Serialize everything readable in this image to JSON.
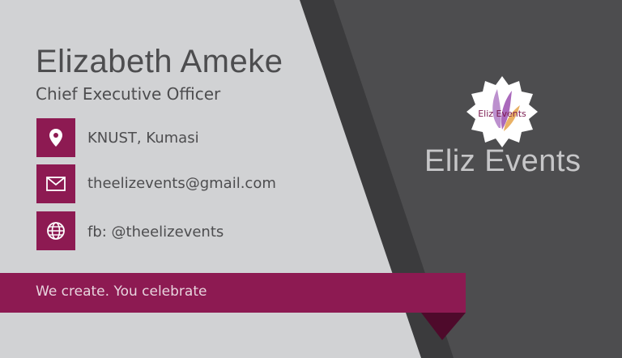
{
  "person": {
    "name": "Elizabeth Ameke",
    "title": "Chief Executive Officer"
  },
  "contacts": [
    {
      "icon": "location-pin-icon",
      "text": "KNUST, Kumasi"
    },
    {
      "icon": "envelope-icon",
      "text": "theelizevents@gmail.com"
    },
    {
      "icon": "globe-icon",
      "text": "fb: @theelizevents"
    }
  ],
  "tagline": "We create. You celebrate",
  "brand": {
    "name": "Eliz Events",
    "logo_text": "Eliz Events"
  },
  "colors": {
    "accent": "#8d1a52",
    "light_panel": "#d1d2d4",
    "dark_panel": "#4d4d4f",
    "brand_text": "#c6c6c8"
  }
}
